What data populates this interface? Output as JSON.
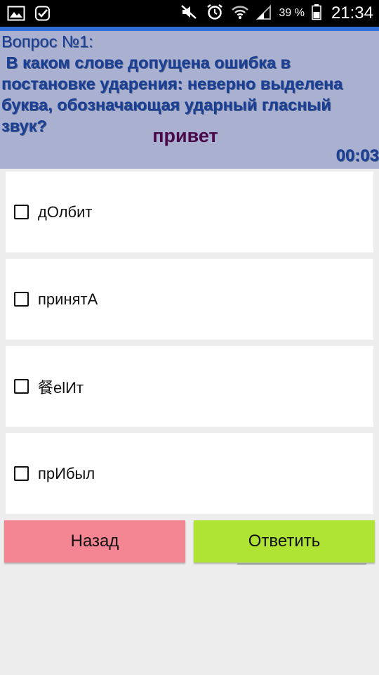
{
  "status_bar": {
    "left_icons": [
      "image-icon",
      "checkbox-done-icon"
    ],
    "right_icons": [
      "mute-icon",
      "alarm-icon",
      "wifi-icon",
      "signal-icon",
      "battery-icon"
    ],
    "battery": "39 %",
    "time": "21:34"
  },
  "question": {
    "number_label": "Вопрос №1:",
    "text": " В каком слове допущена ошибка в постановке ударения: неверно выделена буква, обозначающая ударный гласный звук?",
    "greeting": "привет",
    "timer": "00:03"
  },
  "answers": [
    {
      "label": "дОлбит",
      "checked": false
    },
    {
      "label": "принятА",
      "checked": false
    },
    {
      "label": "餐elИт",
      "checked": false
    },
    {
      "label": "прИбыл",
      "checked": false
    }
  ],
  "buttons": {
    "back": "Назад",
    "submit": "Ответить"
  },
  "colors": {
    "status_bar": "#000000",
    "accent": "#2f6ed2",
    "question_panel": "#aab0cf",
    "question_text": "#1b3f94",
    "greeting": "#4a0a4a",
    "back_button": "#f48593",
    "submit_button": "#afe334",
    "background": "#ededed"
  }
}
